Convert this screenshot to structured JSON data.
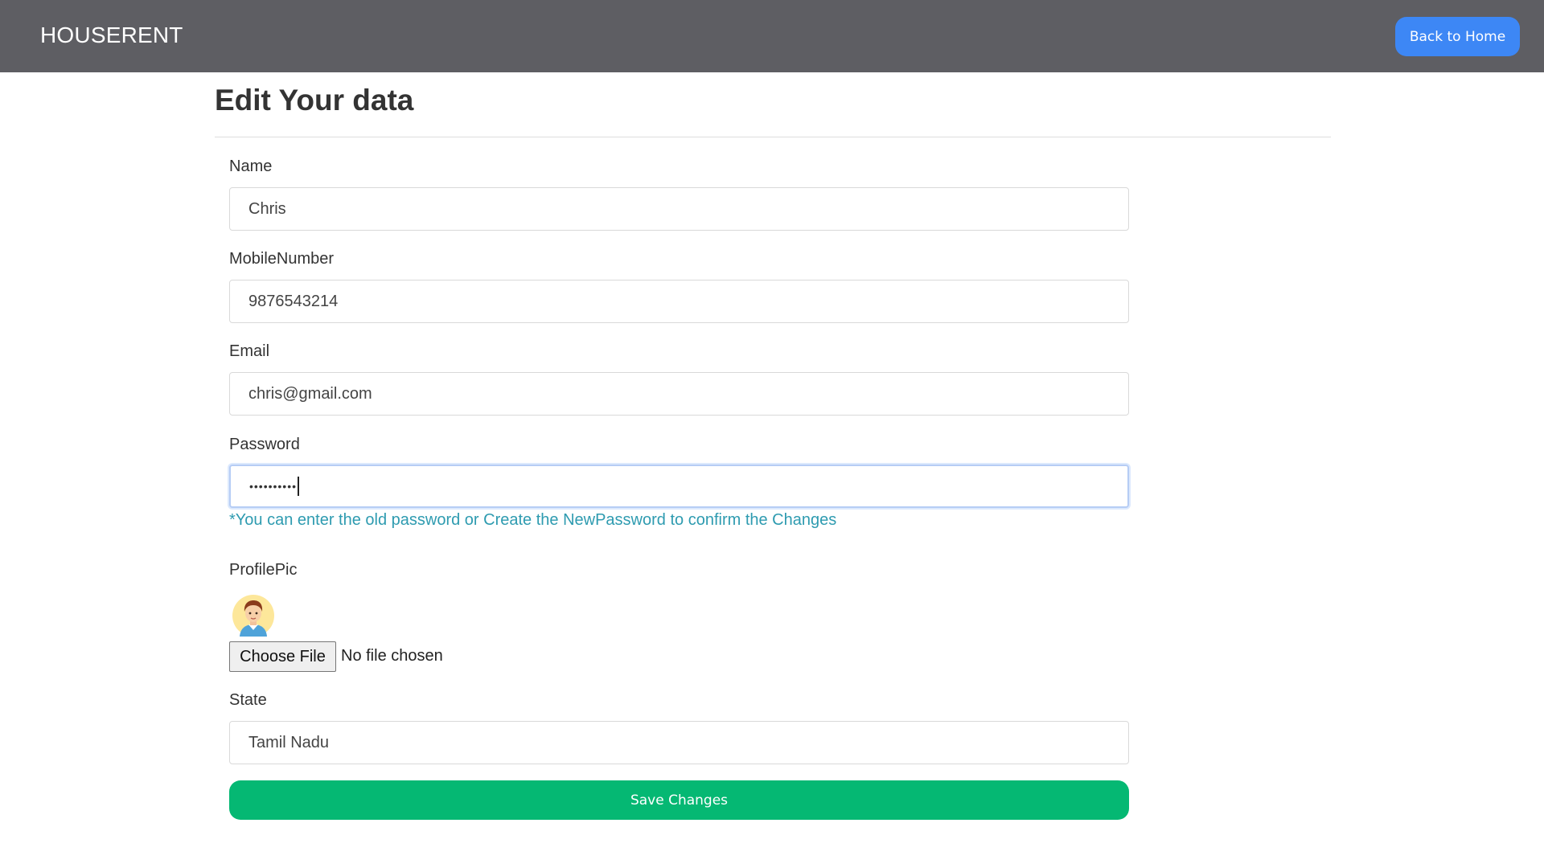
{
  "navbar": {
    "brand": "HOUSERENT",
    "back_button": "Back to Home",
    "bg_color": "#5e5e63",
    "button_color": "#3d87f5"
  },
  "page": {
    "title": "Edit Your data"
  },
  "form": {
    "name": {
      "label": "Name",
      "value": "Chris"
    },
    "mobile": {
      "label": "MobileNumber",
      "value": "9876543214"
    },
    "email": {
      "label": "Email",
      "value": "chris@gmail.com"
    },
    "password": {
      "label": "Password",
      "masked_value": "••••••••••"
    },
    "password_hint": "*You can enter the old password or Create the NewPassword to confirm the Changes",
    "profile_pic": {
      "label": "ProfilePic",
      "avatar_icon": "user-avatar-icon",
      "choose_label": "Choose File",
      "file_status": "No file chosen"
    },
    "state": {
      "label": "State",
      "value": "Tamil Nadu"
    },
    "save_button": "Save Changes",
    "save_color": "#05b873",
    "hint_color": "#2e9bb0"
  }
}
